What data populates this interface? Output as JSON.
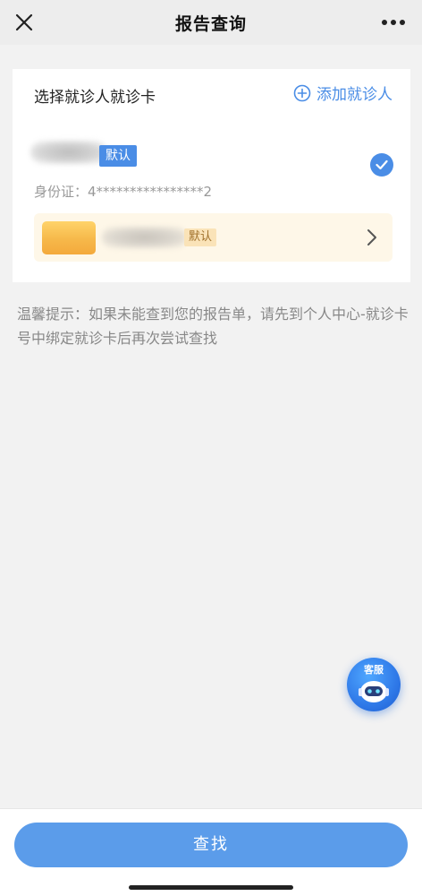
{
  "navbar": {
    "title": "报告查询",
    "close_icon": "close-icon",
    "more_icon": "more-dots-icon"
  },
  "patient_card": {
    "title": "选择就诊人就诊卡",
    "add_label": "添加就诊人",
    "add_icon": "plus-circle-icon",
    "default_badge": "默认",
    "id_label": "身份证：",
    "id_value": "4****************2",
    "selected": true,
    "card_row": {
      "default_badge": "默认",
      "chevron_icon": "chevron-right-icon"
    }
  },
  "tip": {
    "text": "温馨提示：如果未能查到您的报告单，请先到个人中心-就诊卡号中绑定就诊卡后再次尝试查找"
  },
  "service": {
    "label": "客服",
    "icon": "robot-icon"
  },
  "bottom": {
    "search_label": "查找"
  },
  "colors": {
    "accent": "#4a8de6",
    "button": "#5b9cea",
    "card_row_bg": "#fef7e8",
    "badge_orange_bg": "#fae3b8",
    "badge_orange_text": "#a0702a"
  }
}
